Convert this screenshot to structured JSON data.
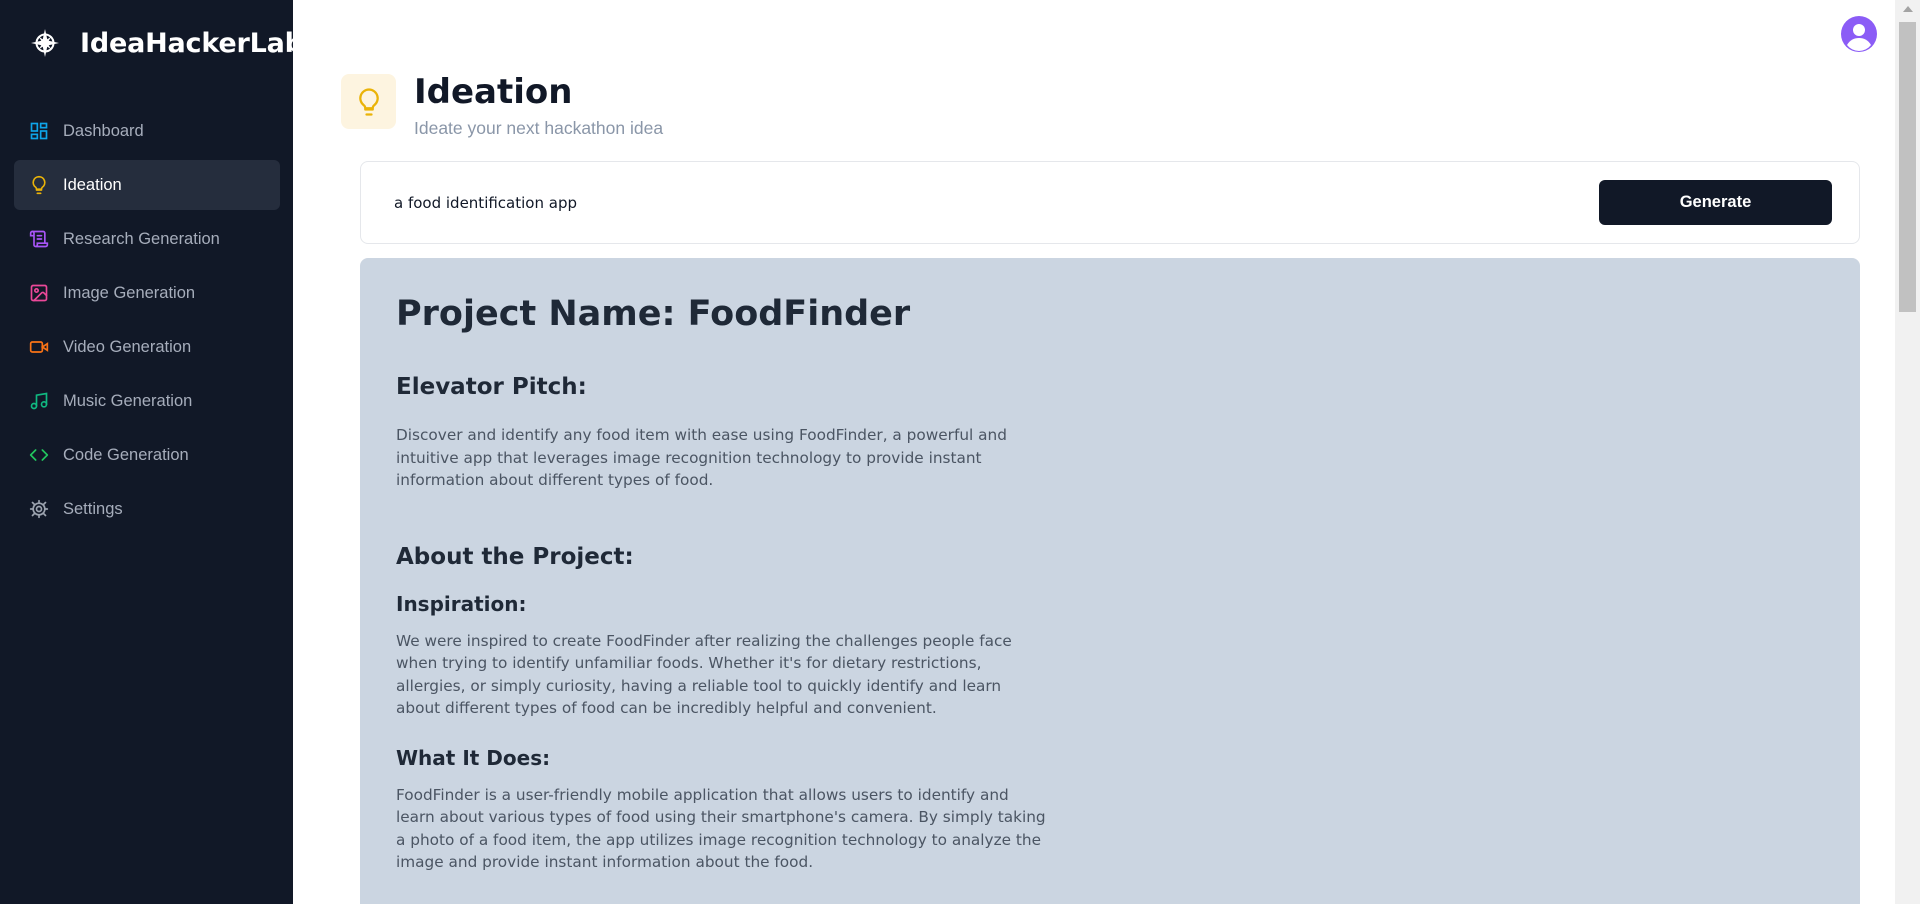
{
  "app": {
    "name": "IdeaHackerLab"
  },
  "sidebar": {
    "items": [
      {
        "label": "Dashboard",
        "icon": "dashboard-icon",
        "color": "#0ea5e9",
        "active": false
      },
      {
        "label": "Ideation",
        "icon": "lightbulb-icon",
        "color": "#eab308",
        "active": true
      },
      {
        "label": "Research Generation",
        "icon": "scroll-icon",
        "color": "#a855f7",
        "active": false
      },
      {
        "label": "Image Generation",
        "icon": "image-icon",
        "color": "#ec4899",
        "active": false
      },
      {
        "label": "Video Generation",
        "icon": "video-icon",
        "color": "#f97316",
        "active": false
      },
      {
        "label": "Music Generation",
        "icon": "music-icon",
        "color": "#10b981",
        "active": false
      },
      {
        "label": "Code Generation",
        "icon": "code-icon",
        "color": "#22c55e",
        "active": false
      },
      {
        "label": "Settings",
        "icon": "gear-icon",
        "color": "#9ca3af",
        "active": false
      }
    ]
  },
  "header": {
    "title": "Ideation",
    "subtitle": "Ideate your next hackathon idea"
  },
  "prompt": {
    "value": "a food identification app",
    "button_label": "Generate"
  },
  "result": {
    "project_title": "Project Name: FoodFinder",
    "pitch_heading": "Elevator Pitch:",
    "pitch_text": "Discover and identify any food item with ease using FoodFinder, a powerful and intuitive app that leverages image recognition technology to provide instant information about different types of food.",
    "about_heading": "About the Project:",
    "inspiration_heading": "Inspiration:",
    "inspiration_text": "We were inspired to create FoodFinder after realizing the challenges people face when trying to identify unfamiliar foods. Whether it's for dietary restrictions, allergies, or simply curiosity, having a reliable tool to quickly identify and learn about different types of food can be incredibly helpful and convenient.",
    "what_heading": "What It Does:",
    "what_text": "FoodFinder is a user-friendly mobile application that allows users to identify and learn about various types of food using their smartphone's camera. By simply taking a photo of a food item, the app utilizes image recognition technology to analyze the image and provide instant information about the food."
  },
  "colors": {
    "sidebar_bg": "#111827",
    "active_item_bg": "#252d3d",
    "result_bg": "#cbd5e1",
    "avatar": "#8b5cf6",
    "button_bg": "#111827"
  }
}
